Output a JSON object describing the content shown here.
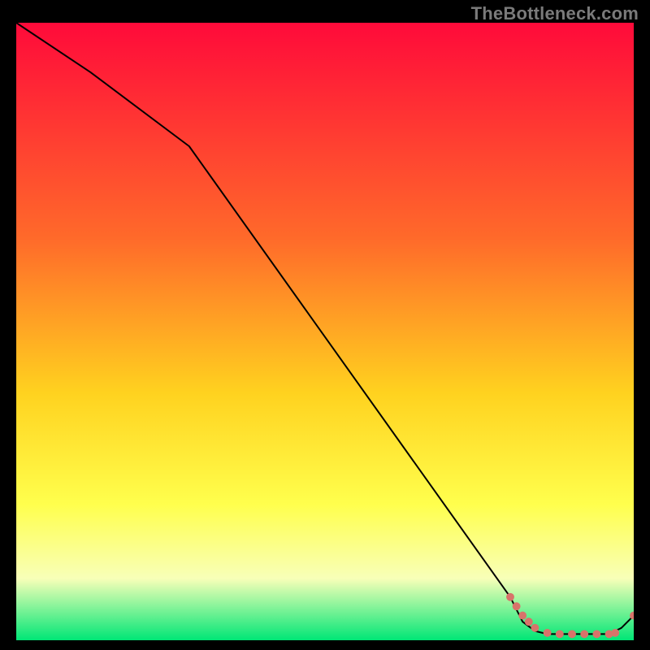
{
  "watermark": "TheBottleneck.com",
  "colors": {
    "background": "#000000",
    "gradient_top": "#ff0a3a",
    "gradient_mid1": "#ff6a2a",
    "gradient_mid2": "#ffd21f",
    "gradient_mid3": "#ffff4d",
    "gradient_mid4": "#f8ffb8",
    "gradient_bottom": "#00e676",
    "line": "#000000",
    "marker": "#d8736a"
  },
  "chart_data": {
    "type": "line",
    "title": "",
    "xlabel": "",
    "ylabel": "",
    "xlim": [
      0,
      100
    ],
    "ylim": [
      0,
      100
    ],
    "series": [
      {
        "name": "curve",
        "x": [
          0,
          12,
          28,
          80,
          82,
          84,
          86,
          88,
          90,
          92,
          94,
          96,
          98,
          100
        ],
        "y": [
          100,
          92,
          80,
          7,
          3,
          1.5,
          1,
          1,
          1,
          1,
          1,
          1,
          2,
          4
        ]
      }
    ],
    "markers": {
      "name": "highlight-points",
      "x": [
        80,
        81,
        82,
        83,
        84,
        86,
        88,
        90,
        92,
        94,
        96,
        97,
        100
      ],
      "y": [
        7,
        5.5,
        4,
        3,
        2,
        1.2,
        1,
        1,
        1,
        1,
        1,
        1.2,
        4
      ]
    }
  }
}
